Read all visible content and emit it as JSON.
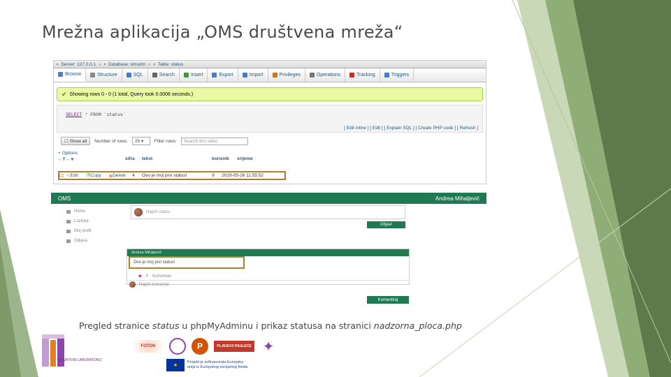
{
  "slide": {
    "title": "Mrežna aplikacija „OMS društvena mreža“"
  },
  "pma": {
    "breadcrumb": {
      "server": "Server: 127.0.0.1",
      "database": "Database: omsdm",
      "table": "Table: status"
    },
    "tabs": [
      {
        "label": "Browse",
        "color": "#4a7cc7"
      },
      {
        "label": "Structure",
        "color": "#8a8a8a"
      },
      {
        "label": "SQL",
        "color": "#4a7cc7"
      },
      {
        "label": "Search",
        "color": "#666666"
      },
      {
        "label": "Insert",
        "color": "#3a9a3a"
      },
      {
        "label": "Export",
        "color": "#4a7cc7"
      },
      {
        "label": "Import",
        "color": "#4a7cc7"
      },
      {
        "label": "Privileges",
        "color": "#c07a20"
      },
      {
        "label": "Operations",
        "color": "#777777"
      },
      {
        "label": "Tracking",
        "color": "#c03030"
      },
      {
        "label": "Triggers",
        "color": "#4a7cc7"
      }
    ],
    "success_message": "Showing rows 0 - 0 (1 total, Query took 0.0006 seconds.)",
    "sql": {
      "keyword": "SELECT",
      "rest": "* FROM `status`"
    },
    "sql_links": "[ Edit inline ] [ Edit ] [ Explain SQL ] [ Create PHP code ] [ Refresh ]",
    "nav": {
      "show_all": "Show all",
      "rows_label": "Number of rows:",
      "rows_value": "25",
      "filter_label": "Filter rows:",
      "filter_placeholder": "Search this table"
    },
    "options_label": "+ Options",
    "columns": [
      "sifra",
      "tekst",
      "korisnik",
      "vrijeme"
    ],
    "row": {
      "edit": "Edit",
      "copy": "Copy",
      "delete": "Delete",
      "sifra": "4",
      "tekst": "Ovo je moj prvi status!",
      "korisnik": "9",
      "vrijeme": "2019-05-26 11:55:52"
    }
  },
  "oms": {
    "app_name": "OMS",
    "user_name": "Andrea Mihaljević",
    "sidebar": [
      "Home",
      "Lozinka",
      "Moj profil",
      "Odjava"
    ],
    "status_placeholder": "Napiši status",
    "post_button": "Objavi",
    "post": {
      "author": "Andrea Mihaljević",
      "text": "Ovo je moj prvi status!",
      "likes": "0",
      "comments_label": "Komentari",
      "comment_placeholder": "Napiši komentar",
      "comment_button": "Komentiraj"
    },
    "accent_color": "#1f7a52"
  },
  "caption": {
    "part1": "Pregled stranice ",
    "status_word": "status",
    "part2": " u phpMyAdminu i prikaz statusa na stranici ",
    "page_name": "nadzorna_ploca.php"
  },
  "logos": {
    "foton": "FOTON",
    "school": "PLJESOVI PAULEĆE",
    "eu_text_line1": "Projekt je sufinancirala Europska",
    "eu_text_line2": "unija iz Europskog socijalnog fonda",
    "lab_text": "INOVATIVNI LABORATORIJ"
  }
}
